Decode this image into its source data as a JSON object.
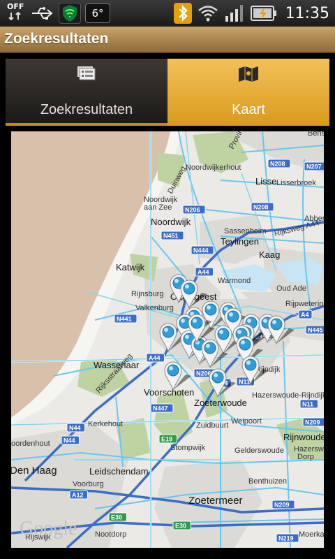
{
  "status_bar": {
    "usb_off_label": "OFF",
    "temperature": "6°",
    "time": "11:35",
    "icons": [
      "usb-debug-icon",
      "usb-icon",
      "shield-icon",
      "bluetooth-icon",
      "wifi-icon",
      "signal-icon",
      "battery-icon"
    ]
  },
  "title_bar": {
    "title": "Zoekresultaten"
  },
  "tabs": [
    {
      "label": "Zoekresultaten",
      "icon": "list-icon",
      "selected": true
    },
    {
      "label": "Kaart",
      "icon": "map-icon",
      "selected": false
    }
  ],
  "map": {
    "places": {
      "noordwijkerhout": "Noordwijkerhout",
      "lisse": "Lisse",
      "lisserbroek": "Lisserbroek",
      "noordwijk_aan_zee_1": "Noordwijk",
      "noordwijk_aan_zee_2": "aan Zee",
      "noordwijk": "Noordwijk",
      "sassenheim": "Sassenheim",
      "teylingen": "Teylingen",
      "abbenes": "Abbenes",
      "katwijk": "Katwijk",
      "kaag": "Kaag",
      "rijnsburg": "Rijnsburg",
      "oegstgeest": "Oegstgeest",
      "warmond": "Warmond",
      "oud_ade": "Oud Ade",
      "valkenburg": "Valkenburg",
      "rijpwetering": "Rijpwetering",
      "leiderdorp": "rdorp",
      "wassenaar": "Wassenaar",
      "rijndijk": "Rijndijk",
      "hazerswoude_rijndijk": "Hazerswoude-Rijndijk",
      "voorschoten": "Voorschoten",
      "zoeterwoude": "Zoeterwoude",
      "kerkehout": "Kerkehout",
      "weipoort": "Weipoort",
      "zuidbuurt": "Zuidbuurt",
      "rijnwoude": "Rijnwoude",
      "hazerswoude_dorp_1": "Hazerswoude-",
      "hazerswoude_dorp_2": "Dorp",
      "stompwijk": "Stompwijk",
      "gelderswoude": "Gelderswoude",
      "den_haag": "Den Haag",
      "leidschendam": "Leidschendam",
      "voorburg": "Voorburg",
      "benthuizen": "Benthuizen",
      "zoetermeer": "Zoetermeer",
      "rijswijk": "Rijswijk",
      "nootdorp": "Nootdorp",
      "moerkapelle": "Moerka",
      "oordenhout": "oordenhout",
      "bennebroek": "Bens"
    },
    "roads": {
      "duinweg": "Duinweg",
      "provinciale": "Provincia",
      "rijksweg_a44": "Rijksweg A44",
      "rijksstraatweg": "Rijksstraatweg"
    },
    "shields": {
      "n208_top": "N208",
      "n207": "N207",
      "n206": "N206",
      "n208_mid": "N208",
      "n451": "N451",
      "n444": "N444",
      "a44_a": "A44",
      "n441": "N441",
      "a4_e": "A4",
      "n445": "N445",
      "a44_b": "A44",
      "n206_b": "N206",
      "a4_mid": "A4",
      "n11_a": "N11",
      "n447": "N447",
      "n11_b": "N11",
      "n44_a": "N44",
      "n209_a": "N209",
      "n44_b": "N44",
      "e19": "E19",
      "a12": "A12",
      "e30_a": "E30",
      "e30_b": "E30",
      "n209_b": "N209",
      "n219": "N219"
    },
    "attribution": "Google",
    "colors": {
      "sea": "#d8c0aa",
      "land": "#eceae6",
      "water": "#66c7ee",
      "town": "#dcdad4",
      "forest": "#bfd3a2",
      "pin_blue": "#2f9fd9"
    },
    "marker_count": 22
  }
}
